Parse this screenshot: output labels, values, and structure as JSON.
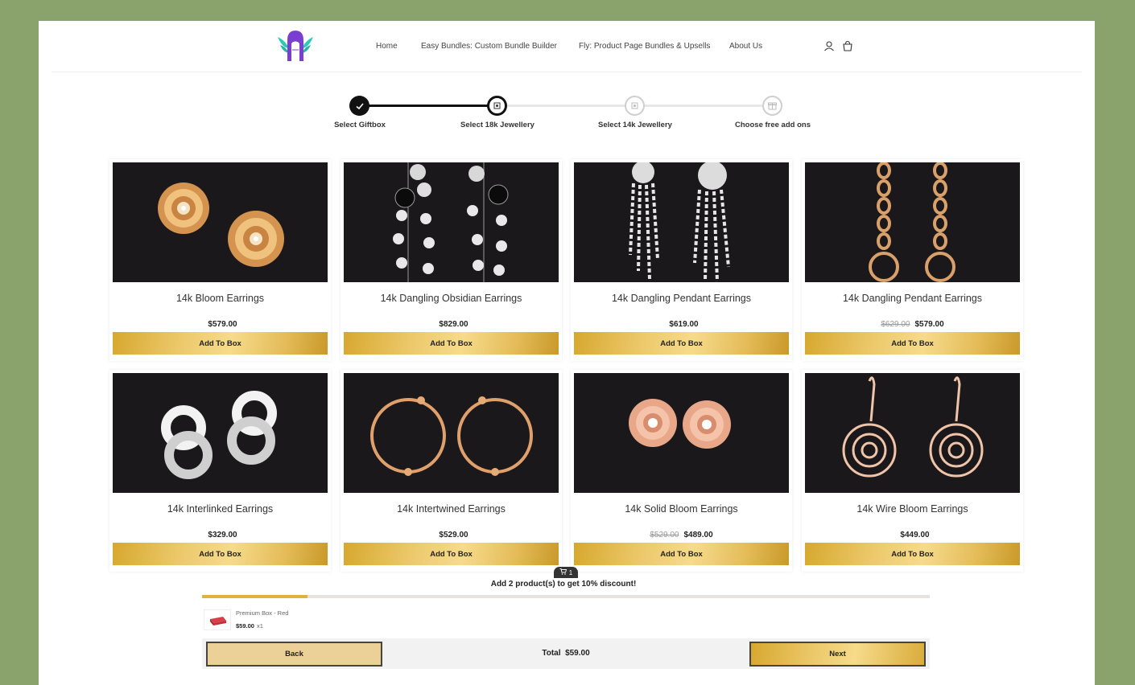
{
  "nav": {
    "links": [
      "Home",
      "Easy Bundles: Custom Bundle Builder",
      "Fly: Product Page Bundles & Upsells",
      "About Us"
    ]
  },
  "header": {
    "icons": [
      "user-icon",
      "cart-bag-icon"
    ]
  },
  "stepper": {
    "steps": [
      {
        "label": "Select Giftbox",
        "state": "completed"
      },
      {
        "label": "Select 18k Jewellery",
        "state": "active"
      },
      {
        "label": "Select 14k Jewellery",
        "state": "upcoming"
      },
      {
        "label": "Choose free add ons",
        "state": "upcoming"
      }
    ]
  },
  "products": [
    {
      "title": "14k Bloom Earrings",
      "old_price": "",
      "price": "$579.00",
      "button": "Add To Box",
      "image": "gold-rose-stud-earrings"
    },
    {
      "title": "14k Dangling Obsidian Earrings",
      "old_price": "",
      "price": "$829.00",
      "button": "Add To Box",
      "image": "diamond-obsidian-drop-earrings"
    },
    {
      "title": "14k Dangling Pendant Earrings",
      "old_price": "",
      "price": "$619.00",
      "button": "Add To Box",
      "image": "diamond-tassel-earrings"
    },
    {
      "title": "14k Dangling Pendant Earrings",
      "old_price": "$629.00",
      "price": "$579.00",
      "button": "Add To Box",
      "image": "gold-chain-drop-earrings"
    },
    {
      "title": "14k Interlinked Earrings",
      "old_price": "",
      "price": "$329.00",
      "button": "Add To Box",
      "image": "white-interlinked-hoop-earrings"
    },
    {
      "title": "14k Intertwined Earrings",
      "old_price": "",
      "price": "$529.00",
      "button": "Add To Box",
      "image": "rose-gold-branch-hoop-earrings"
    },
    {
      "title": "14k Solid Bloom Earrings",
      "old_price": "$529.00",
      "price": "$489.00",
      "button": "Add To Box",
      "image": "rose-gold-solid-rose-studs"
    },
    {
      "title": "14k Wire Bloom Earrings",
      "old_price": "",
      "price": "$449.00",
      "button": "Add To Box",
      "image": "rose-gold-wire-rose-drop-earrings"
    }
  ],
  "footer": {
    "cart_count": "1",
    "discount_message": "Add 2 product(s) to get 10% discount!",
    "progress": 0.145,
    "selected_item": {
      "name": "Premium Box - Red",
      "price": "$59.00",
      "qty": "x1"
    },
    "back_label": "Back",
    "total_label": "Total",
    "total_value": "$59.00",
    "next_label": "Next"
  },
  "colors": {
    "page_background": "#8aa36d",
    "gold_accent": "#e0b23d",
    "image_background": "#1b181b"
  }
}
